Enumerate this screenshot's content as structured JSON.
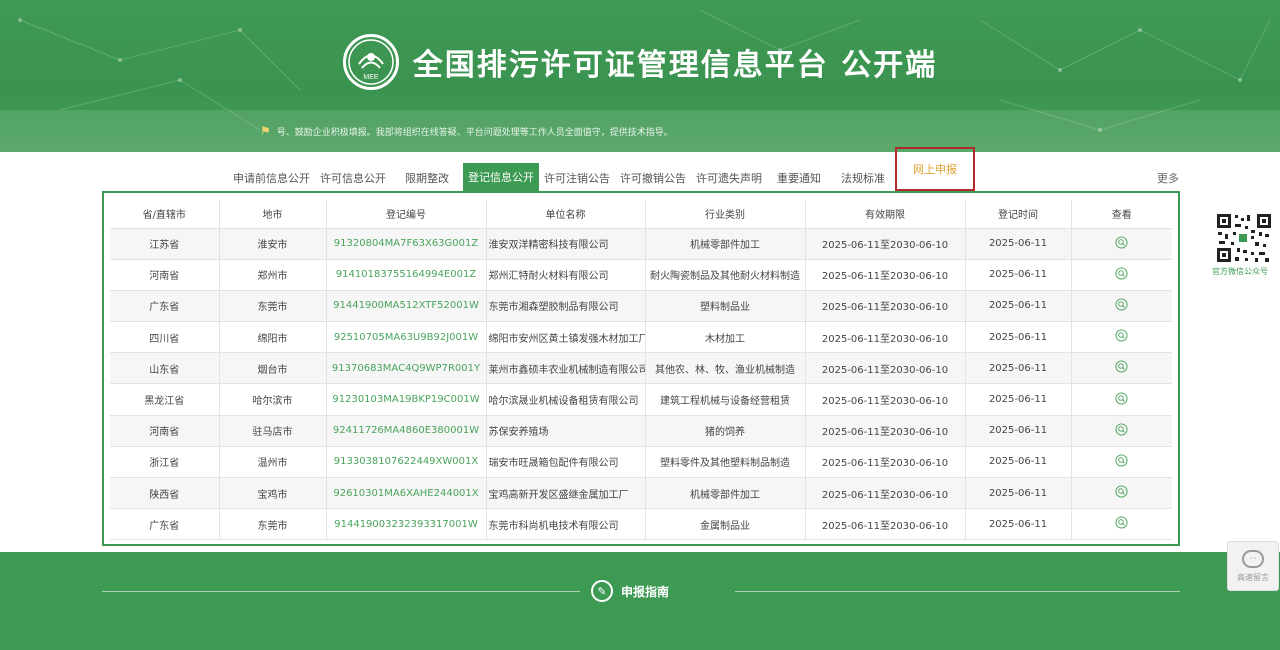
{
  "header": {
    "title": "全国排污许可证管理信息平台  公开端",
    "notice": "号、鼓励企业积极填报。我部将组织在线答疑、平台问题处理等工作人员全面值守，提供技术指导。"
  },
  "tabs": [
    {
      "label": "申请前信息公开"
    },
    {
      "label": "许可信息公开"
    },
    {
      "label": "限期整改"
    },
    {
      "label": "登记信息公开"
    },
    {
      "label": "许可注销公告"
    },
    {
      "label": "许可撤销公告"
    },
    {
      "label": "许可遗失声明"
    },
    {
      "label": "重要通知"
    },
    {
      "label": "法规标准"
    },
    {
      "label": "网上申报"
    }
  ],
  "more_label": "更多",
  "table": {
    "headers": [
      "省/直辖市",
      "地市",
      "登记编号",
      "单位名称",
      "行业类别",
      "有效期限",
      "登记时间",
      "查看"
    ],
    "rows": [
      [
        "江苏省",
        "淮安市",
        "91320804MA7F63X63G001Z",
        "淮安双洋精密科技有限公司",
        "机械零部件加工",
        "2025-06-11至2030-06-10",
        "2025-06-11"
      ],
      [
        "河南省",
        "郑州市",
        "91410183755164994E001Z",
        "郑州汇特耐火材料有限公司",
        "耐火陶瓷制品及其他耐火材料制造",
        "2025-06-11至2030-06-10",
        "2025-06-11"
      ],
      [
        "广东省",
        "东莞市",
        "91441900MA512XTF52001W",
        "东莞市湘森塑胶制品有限公司",
        "塑料制品业",
        "2025-06-11至2030-06-10",
        "2025-06-11"
      ],
      [
        "四川省",
        "绵阳市",
        "92510705MA63U9B92J001W",
        "绵阳市安州区黄土镇发强木材加工厂",
        "木材加工",
        "2025-06-11至2030-06-10",
        "2025-06-11"
      ],
      [
        "山东省",
        "烟台市",
        "91370683MAC4Q9WP7R001Y",
        "莱州市鑫硕丰农业机械制造有限公司",
        "其他农、林、牧、渔业机械制造",
        "2025-06-11至2030-06-10",
        "2025-06-11"
      ],
      [
        "黑龙江省",
        "哈尔滨市",
        "91230103MA19BKP19C001W",
        "哈尔滨晟业机械设备租赁有限公司",
        "建筑工程机械与设备经营租赁",
        "2025-06-11至2030-06-10",
        "2025-06-11"
      ],
      [
        "河南省",
        "驻马店市",
        "92411726MA4860E380001W",
        "苏保安养殖场",
        "猪的饲养",
        "2025-06-11至2030-06-10",
        "2025-06-11"
      ],
      [
        "浙江省",
        "温州市",
        "91330381076224​49XW001X",
        "瑞安市旺晟箱包配件有限公司",
        "塑料零件及其他塑料制品制造",
        "2025-06-11至2030-06-10",
        "2025-06-11"
      ],
      [
        "陕西省",
        "宝鸡市",
        "92610301MA6XAHE244001X",
        "宝鸡高新开发区盛继金属加工厂",
        "机械零部件加工",
        "2025-06-11至2030-06-10",
        "2025-06-11"
      ],
      [
        "广东省",
        "东莞市",
        "91441900323239331700​1W",
        "东莞市科尚机电技术有限公司",
        "金属制品业",
        "2025-06-11至2030-06-10",
        "2025-06-11"
      ]
    ]
  },
  "side": {
    "qr_label": "官方微信公众号",
    "chat_label": "高速留言"
  },
  "footer": {
    "guide_label": "申报指南"
  },
  "colors": {
    "brand_green": "#3d9a53",
    "code_green": "#4aa45c",
    "highlight_border": "#b32a2a",
    "highlight_text": "#e0a030"
  }
}
